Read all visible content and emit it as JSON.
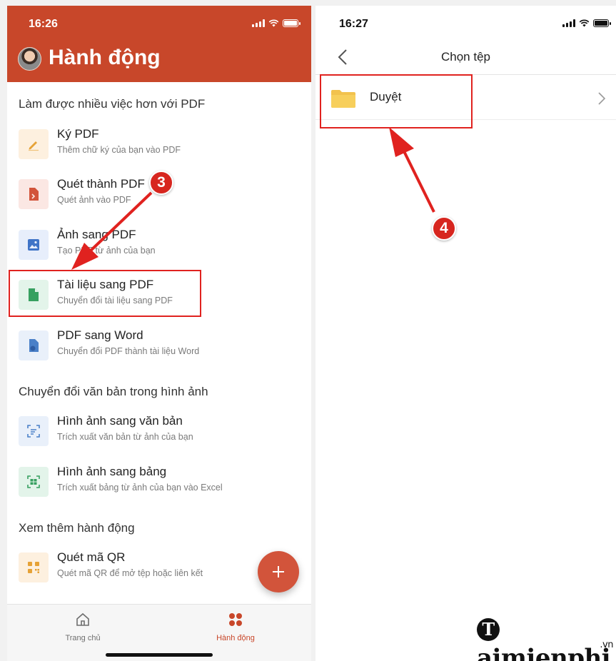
{
  "left": {
    "status": {
      "time": "16:26"
    },
    "header": {
      "title": "Hành động"
    },
    "sections": [
      {
        "title": "Làm được nhiều việc hơn với PDF"
      },
      {
        "title": "Chuyển đổi văn bản trong hình ảnh"
      },
      {
        "title": "Xem thêm hành động"
      }
    ],
    "items": [
      {
        "title": "Ký PDF",
        "subtitle": "Thêm chữ ký của bạn vào PDF",
        "icon": "pen-icon",
        "color": "#e6a236"
      },
      {
        "title": "Quét thành PDF",
        "subtitle": "Quét ảnh vào PDF",
        "icon": "scan-doc-icon",
        "color": "#d2543b"
      },
      {
        "title": "Ảnh sang PDF",
        "subtitle": "Tạo PDF từ ảnh của bạn",
        "icon": "image-icon",
        "color": "#3f74c7"
      },
      {
        "title": "Tài liệu sang PDF",
        "subtitle": "Chuyển đổi tài liệu sang PDF",
        "icon": "document-icon",
        "color": "#37a060"
      },
      {
        "title": "PDF sang Word",
        "subtitle": "Chuyển đổi PDF thành tài liệu Word",
        "icon": "word-doc-icon",
        "color": "#4a80c8"
      },
      {
        "title": "Hình ảnh sang văn bản",
        "subtitle": "Trích xuất văn bản từ ảnh của bạn",
        "icon": "text-scan-icon",
        "color": "#4a80c8"
      },
      {
        "title": "Hình ảnh sang bảng",
        "subtitle": "Trích xuất bảng từ ảnh của bạn vào Excel",
        "icon": "table-scan-icon",
        "color": "#37a060"
      },
      {
        "title": "Quét mã QR",
        "subtitle": "Quét mã QR để mở tệp hoặc liên kết",
        "icon": "qr-code-icon",
        "color": "#e6a236"
      }
    ],
    "tabs": [
      {
        "label": "Trang chủ",
        "icon": "home-icon",
        "active": false
      },
      {
        "label": "Hành động",
        "icon": "grid-icon",
        "active": true
      }
    ],
    "fab": {
      "icon": "plus-icon"
    }
  },
  "right": {
    "status": {
      "time": "16:27"
    },
    "nav": {
      "title": "Chọn tệp"
    },
    "rows": [
      {
        "label": "Duyệt",
        "icon": "folder-icon"
      }
    ]
  },
  "annotations": {
    "step3": "3",
    "step4": "4",
    "highlight_color": "#e0221f"
  },
  "watermark": {
    "brand": "aimienphi",
    "suffix": ".vn"
  },
  "colors": {
    "brand": "#c8472a",
    "accent": "#d2543b"
  }
}
